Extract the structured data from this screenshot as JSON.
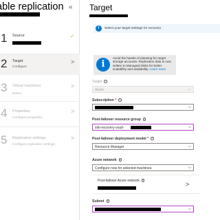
{
  "left_pane": {
    "title": "able replication",
    "collapse_icon": "«",
    "steps": [
      {
        "num": "1",
        "label": "Source",
        "sub": "",
        "state": "done"
      },
      {
        "num": "2",
        "label": "Target",
        "sub": "Configure",
        "state": "active"
      },
      {
        "num": "3",
        "label": "Virtual machines",
        "sub": "Select",
        "state": "disabled"
      },
      {
        "num": "4",
        "label": "Properties",
        "sub": "Configure properties",
        "state": "disabled"
      },
      {
        "num": "5",
        "label": "Replication settings",
        "sub": "Configure replication settings",
        "state": "disabled"
      }
    ],
    "chevron": ">",
    "check": "✓"
  },
  "right_pane": {
    "title": "Target",
    "info_bar": {
      "icon": "i",
      "text": "Select your target settings for recovery"
    },
    "notice": {
      "icon": "i",
      "text": "Avoid the hassle of planning for target storage accounts. Replication data is now written to Managed Disks for better scalability and availability.",
      "link": "Learn more"
    },
    "target": {
      "label": "Target",
      "value": "Azure"
    },
    "subscription": {
      "label": "Subscription",
      "required": "*",
      "value": ""
    },
    "resource_group": {
      "label": "Post-failover resource group",
      "value": "site-recovery-vault-"
    },
    "deployment_model": {
      "label": "Post-failover deployment model",
      "required": "*",
      "value": "Resource Manager"
    },
    "azure_network": {
      "label": "Azure network",
      "value": "Configure now for selected machines."
    },
    "post_failover_network": {
      "label": "Post-failover Azure network",
      "chevron": ">"
    },
    "subnet": {
      "label": "Subnet",
      "value": ""
    },
    "info_glyph": "i",
    "arrow": "⌵"
  },
  "colors": {
    "accent": "#0078d4",
    "focus_border": "#b146c2",
    "check": "#9bc45e",
    "active_step_bg": "#f3f2f1"
  }
}
